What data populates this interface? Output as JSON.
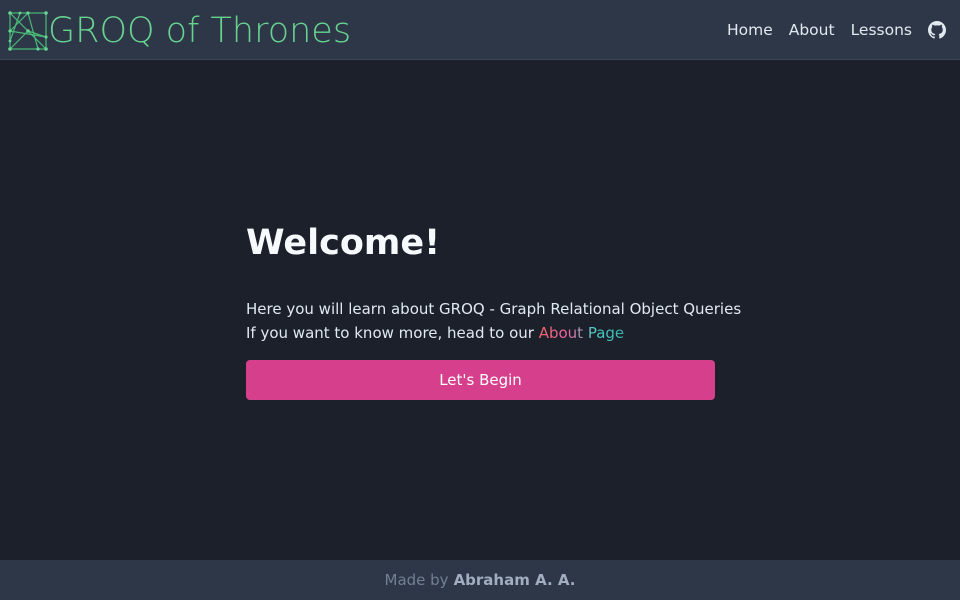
{
  "header": {
    "logo_icon": "graph-network-icon",
    "title": "GROQ of Thrones",
    "nav": [
      {
        "label": "Home"
      },
      {
        "label": "About"
      },
      {
        "label": "Lessons"
      }
    ],
    "github_icon": "github-icon"
  },
  "main": {
    "heading": "Welcome!",
    "intro_line1": "Here you will learn about GROQ - Graph Relational Object Queries",
    "intro_line2_prefix": "If you want to know more, head to our ",
    "about_link": "About Page",
    "cta_label": "Let's Begin"
  },
  "footer": {
    "prefix": "Made by",
    "author": "Abraham A. A."
  },
  "colors": {
    "background": "#1b202b",
    "header_bg": "#2d3748",
    "brand": "#68d391",
    "cta": "#d53f8c"
  }
}
